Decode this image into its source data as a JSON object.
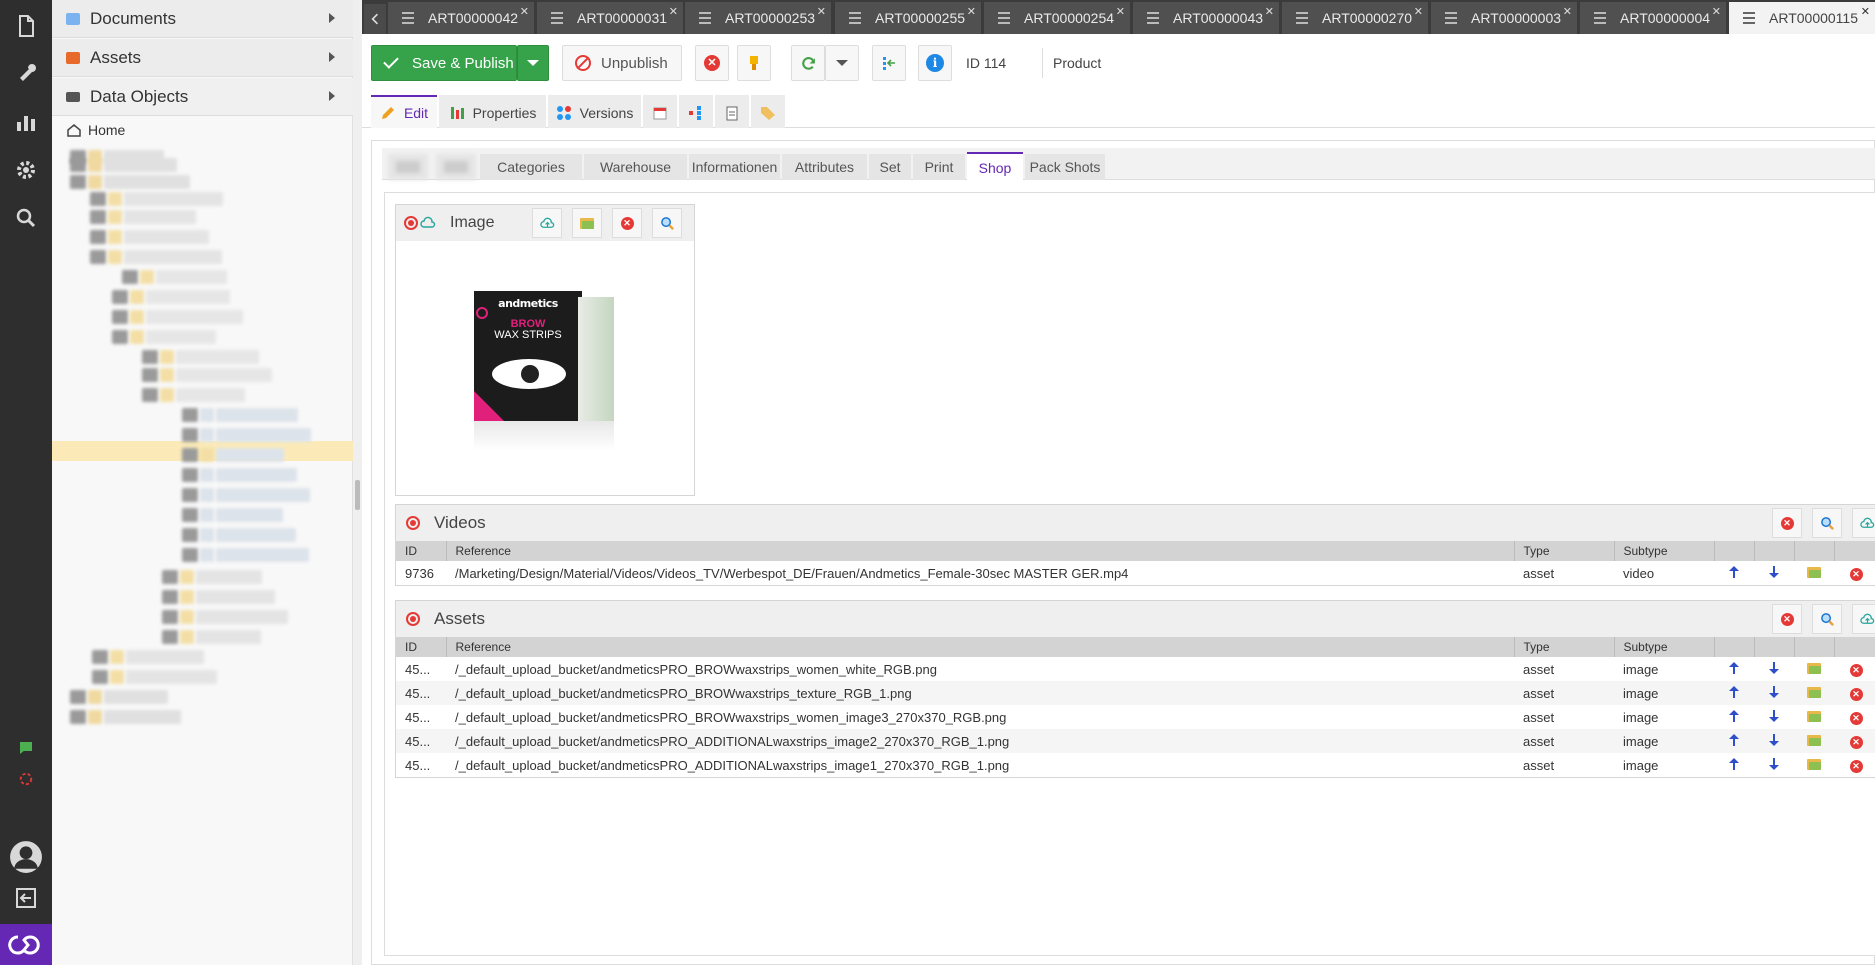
{
  "sidebar": {
    "accordion": [
      {
        "label": "Documents"
      },
      {
        "label": "Assets"
      },
      {
        "label": "Data Objects"
      }
    ],
    "tree_root": "Home"
  },
  "tabs": [
    {
      "label": "ART00000042"
    },
    {
      "label": "ART00000031"
    },
    {
      "label": "ART00000253"
    },
    {
      "label": "ART00000255"
    },
    {
      "label": "ART00000254"
    },
    {
      "label": "ART00000043"
    },
    {
      "label": "ART00000270"
    },
    {
      "label": "ART00000003"
    },
    {
      "label": "ART00000004"
    },
    {
      "label": "ART00000115"
    }
  ],
  "toolbar": {
    "save_label": "Save & Publish",
    "unpublish_label": "Unpublish",
    "id_label": "ID 114",
    "class_label": "Product"
  },
  "subtabs": {
    "edit": "Edit",
    "properties": "Properties",
    "versions": "Versions"
  },
  "innertabs": [
    "Categories",
    "Warehouse",
    "Informationen",
    "Attributes",
    "Set",
    "Print",
    "Shop",
    "Pack Shots"
  ],
  "image_panel": {
    "title": "Image",
    "product": {
      "brand": "andmetics",
      "line1": "BROW",
      "line2": "WAX STRIPS"
    }
  },
  "videos": {
    "title": "Videos",
    "columns": [
      "ID",
      "Reference",
      "Type",
      "Subtype"
    ],
    "rows": [
      {
        "id": "9736",
        "reference": "/Marketing/Design/Material/Videos/Videos_TV/Werbespot_DE/Frauen/Andmetics_Female-30sec MASTER GER.mp4",
        "type": "asset",
        "subtype": "video"
      }
    ]
  },
  "assets": {
    "title": "Assets",
    "columns": [
      "ID",
      "Reference",
      "Type",
      "Subtype"
    ],
    "rows": [
      {
        "id": "45...",
        "reference": "/_default_upload_bucket/andmeticsPRO_BROWwaxstrips_women_white_RGB.png",
        "type": "asset",
        "subtype": "image"
      },
      {
        "id": "45...",
        "reference": "/_default_upload_bucket/andmeticsPRO_BROWwaxstrips_texture_RGB_1.png",
        "type": "asset",
        "subtype": "image"
      },
      {
        "id": "45...",
        "reference": "/_default_upload_bucket/andmeticsPRO_BROWwaxstrips_women_image3_270x370_RGB.png",
        "type": "asset",
        "subtype": "image"
      },
      {
        "id": "45...",
        "reference": "/_default_upload_bucket/andmeticsPRO_ADDITIONALwaxstrips_image2_270x370_RGB_1.png",
        "type": "asset",
        "subtype": "image"
      },
      {
        "id": "45...",
        "reference": "/_default_upload_bucket/andmeticsPRO_ADDITIONALwaxstrips_image1_270x370_RGB_1.png",
        "type": "asset",
        "subtype": "image"
      }
    ]
  },
  "colors": {
    "accent": "#6428b4",
    "save_green": "#36a34b",
    "danger": "#e53935",
    "info": "#1e88e5"
  }
}
